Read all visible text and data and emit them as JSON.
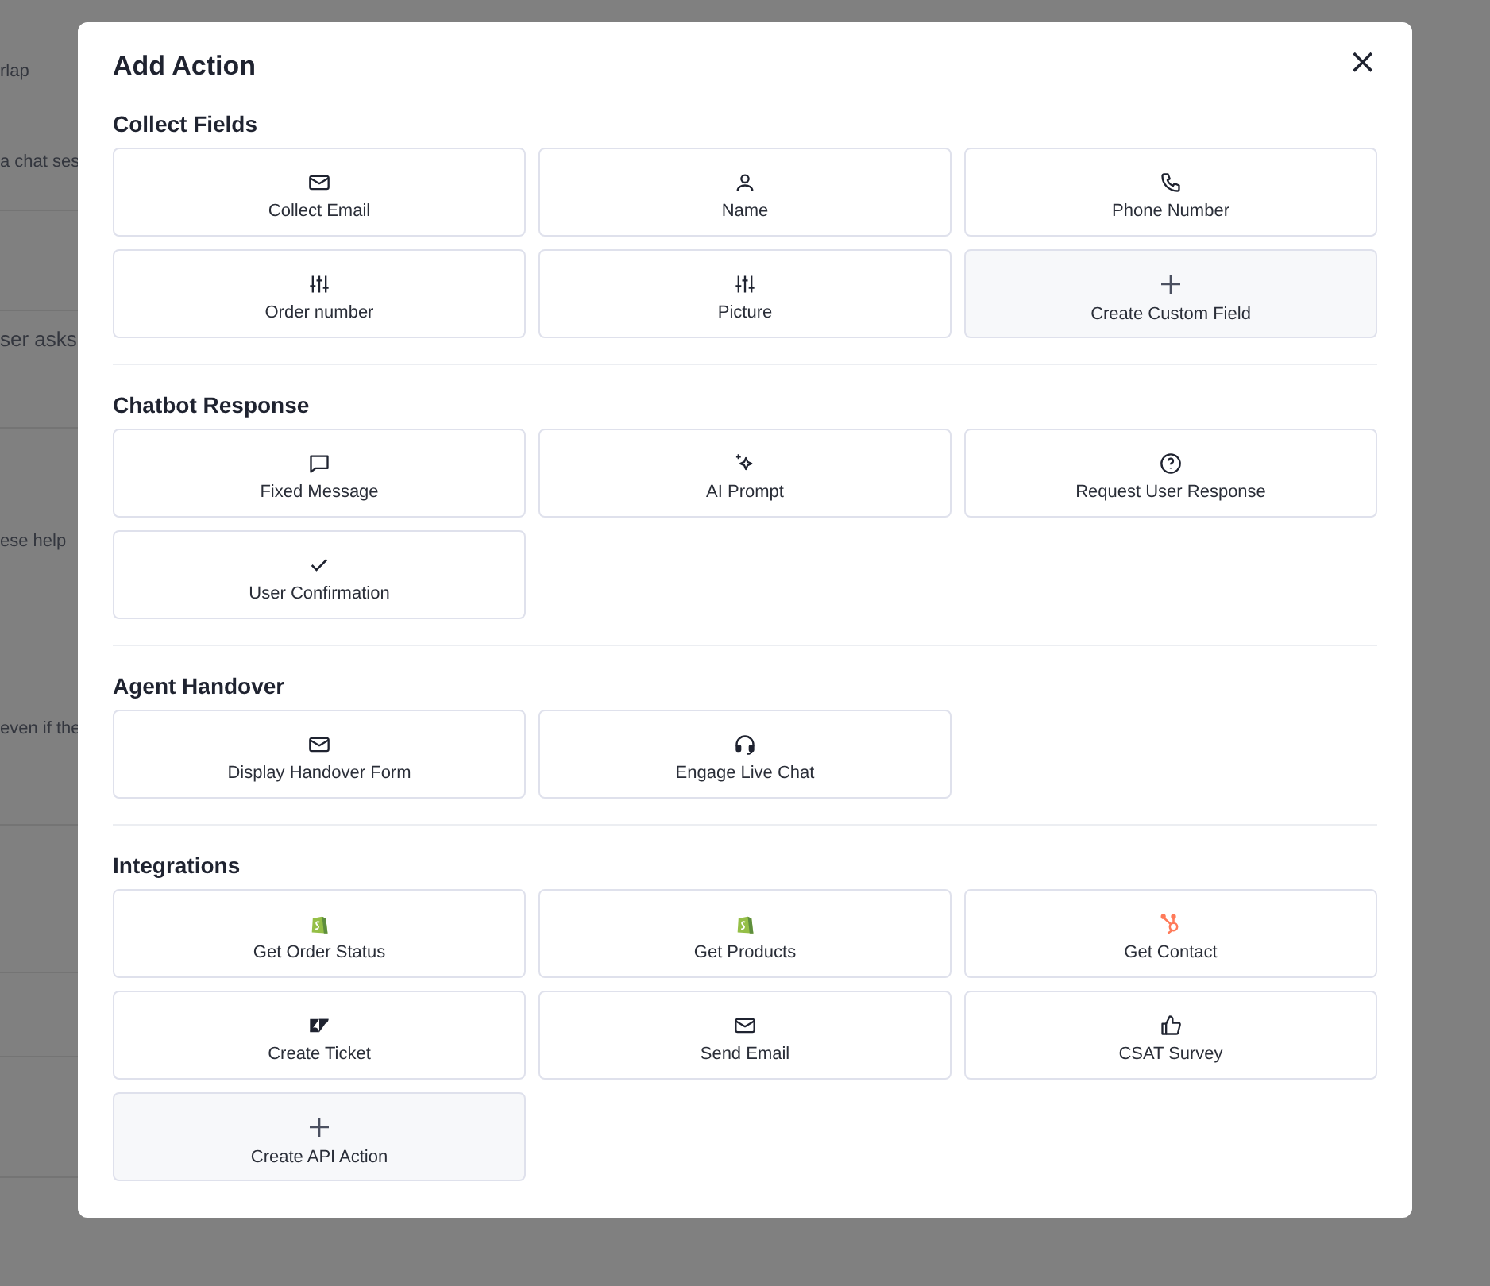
{
  "background": {
    "snippets": [
      "rlap",
      "a chat ses",
      "ser asks",
      "ese help",
      "even if the"
    ]
  },
  "dialog": {
    "title": "Add Action",
    "close": "×",
    "sections": [
      {
        "heading": "Collect Fields",
        "actions": [
          {
            "label": "Collect Email",
            "kind": "mail"
          },
          {
            "label": "Name",
            "kind": "user"
          },
          {
            "label": "Phone Number",
            "kind": "phone"
          },
          {
            "label": "Order number",
            "kind": "sliders"
          },
          {
            "label": "Picture",
            "kind": "sliders"
          },
          {
            "label": "Create Custom Field",
            "kind": "create"
          }
        ]
      },
      {
        "heading": "Chatbot Response",
        "actions": [
          {
            "label": "Fixed Message",
            "kind": "message"
          },
          {
            "label": "AI Prompt",
            "kind": "sparkles"
          },
          {
            "label": "Request User Response",
            "kind": "question"
          },
          {
            "label": "User Confirmation",
            "kind": "check"
          }
        ]
      },
      {
        "heading": "Agent Handover",
        "actions": [
          {
            "label": "Display Handover Form",
            "kind": "mail"
          },
          {
            "label": "Engage Live Chat",
            "kind": "headset"
          }
        ]
      },
      {
        "heading": "Integrations",
        "actions": [
          {
            "label": "Get Order Status",
            "kind": "bag"
          },
          {
            "label": "Get Products",
            "kind": "bag"
          },
          {
            "label": "Get Contact",
            "kind": "hub"
          },
          {
            "label": "Create Ticket",
            "kind": "zed"
          },
          {
            "label": "Send Email",
            "kind": "mail"
          },
          {
            "label": "CSAT Survey",
            "kind": "thumb"
          },
          {
            "label": "Create API Action",
            "kind": "create"
          }
        ]
      }
    ]
  }
}
